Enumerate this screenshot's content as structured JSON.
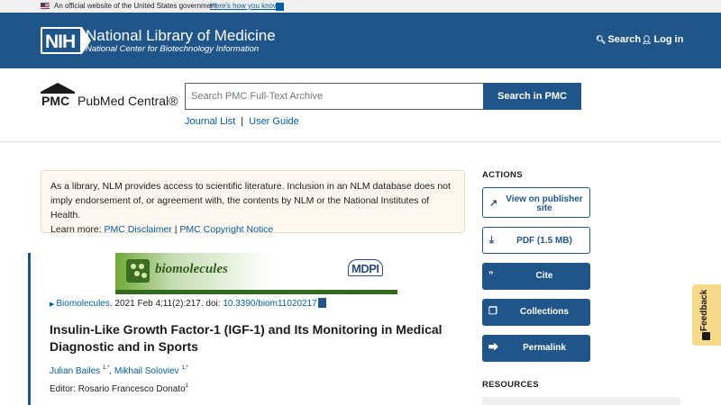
{
  "gov_banner": {
    "text": "An official website of the United States government",
    "link": "Here's how you know"
  },
  "nih_header": {
    "logo_text": "NIH",
    "title": "National Library of Medicine",
    "subtitle": "National Center for Biotechnology Information",
    "search_label": "Search",
    "login_label": "Log in"
  },
  "pmc": {
    "logo_letters": "PMC",
    "name": "PubMed Central®",
    "search_placeholder": "Search PMC Full-Text Archive",
    "search_button": "Search in PMC",
    "links": [
      "Journal List",
      "User Guide"
    ]
  },
  "notice": {
    "text": "As a library, NLM provides access to scientific literature. Inclusion in an NLM database does not imply endorsement of, or agreement with, the contents by NLM or the National Institutes of Health.",
    "learn_more": "Learn more:",
    "links": [
      "PMC Disclaimer",
      "PMC Copyright Notice"
    ],
    "separator": "|"
  },
  "article": {
    "journal_banner": "biomolecules",
    "publisher_logo": "MDPI",
    "journal_link": "Biomolecules",
    "citation": ". 2021 Feb 4;11(2):217. doi: ",
    "doi": "10.3390/biom11020217",
    "title": "Insulin-Like Growth Factor-1 (IGF-1) and Its Monitoring in Medical Diagnostic and in Sports",
    "authors": [
      {
        "name": "Julian Bailes",
        "sup": "1,*"
      },
      {
        "name": "Mikhail Soloviev",
        "sup": "1,*"
      }
    ],
    "editor_prefix": "Editor: ",
    "editor": "Rosario Francesco Donato",
    "editor_sup": "1"
  },
  "actions": {
    "heading": "ACTIONS",
    "view_publisher": "View on publisher site",
    "pdf": "PDF (1.5 MB)",
    "cite": "Cite",
    "collections": "Collections",
    "permalink": "Permalink"
  },
  "resources": {
    "heading": "RESOURCES"
  },
  "feedback": {
    "label": "Feedback"
  },
  "colors": {
    "header_blue": "#20558a",
    "link_blue": "#005ea2",
    "notice_bg": "#fff8f0",
    "feedback_bg": "#f6d98b"
  }
}
